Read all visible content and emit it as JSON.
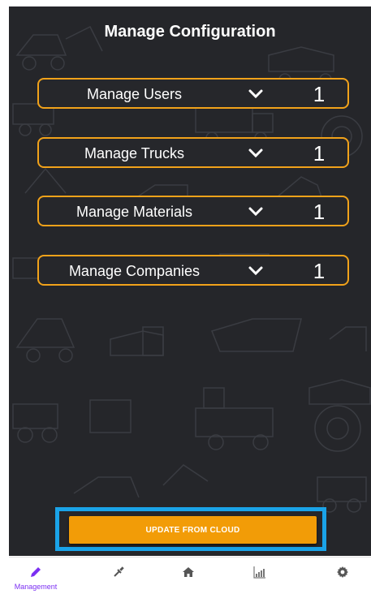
{
  "header": {
    "title": "Manage Configuration"
  },
  "config_items": [
    {
      "label": "Manage Users",
      "count": "1"
    },
    {
      "label": "Manage Trucks",
      "count": "1"
    },
    {
      "label": "Manage Materials",
      "count": "1"
    },
    {
      "label": "Manage Companies",
      "count": "1"
    }
  ],
  "actions": {
    "update_label": "UPDATE FROM CLOUD"
  },
  "nav": {
    "items": [
      {
        "icon": "pencil-icon",
        "label": "Management",
        "active": true
      },
      {
        "icon": "syringe-icon",
        "label": "",
        "active": false
      },
      {
        "icon": "home-icon",
        "label": "",
        "active": false
      },
      {
        "icon": "chart-icon",
        "label": "",
        "active": false
      },
      {
        "icon": "gear-icon",
        "label": "",
        "active": false
      }
    ]
  },
  "colors": {
    "background": "#25262a",
    "accent": "#f29c07",
    "row_border": "#f1a21a",
    "highlight": "#1aa3e8",
    "nav_active": "#7b2ff2",
    "nav_inactive": "#6b6b6b"
  }
}
